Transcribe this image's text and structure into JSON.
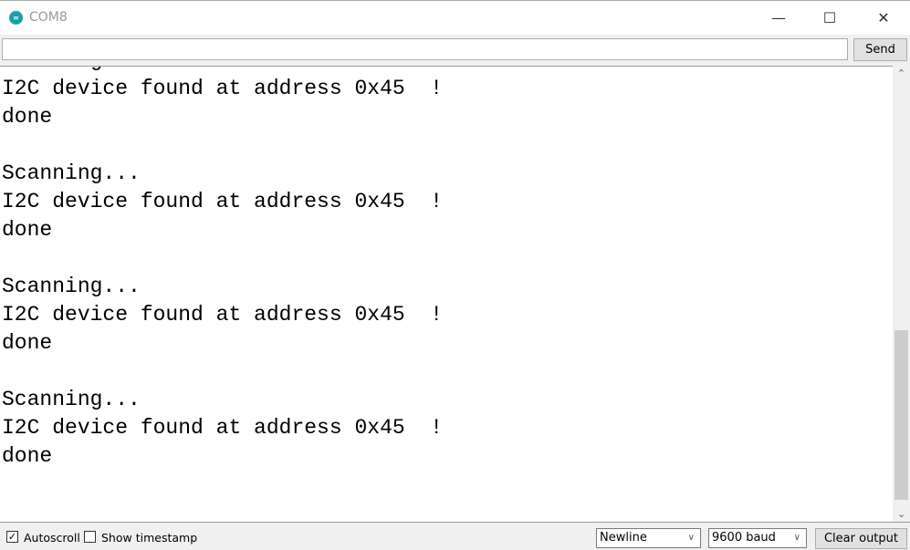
{
  "window": {
    "title": "COM8",
    "accent": "#17a1a5"
  },
  "send": {
    "input_value": "",
    "button_label": "Send"
  },
  "output": {
    "lines": [
      "Scanning...",
      "I2C device found at address 0x45  !",
      "done",
      "",
      "Scanning...",
      "I2C device found at address 0x45  !",
      "done",
      "",
      "Scanning...",
      "I2C device found at address 0x45  !",
      "done",
      "",
      "Scanning...",
      "I2C device found at address 0x45  !",
      "done"
    ]
  },
  "footer": {
    "autoscroll_label": "Autoscroll",
    "autoscroll_checked": true,
    "timestamp_label": "Show timestamp",
    "timestamp_checked": false,
    "line_ending": "Newline",
    "baud": "9600 baud",
    "clear_label": "Clear output"
  }
}
